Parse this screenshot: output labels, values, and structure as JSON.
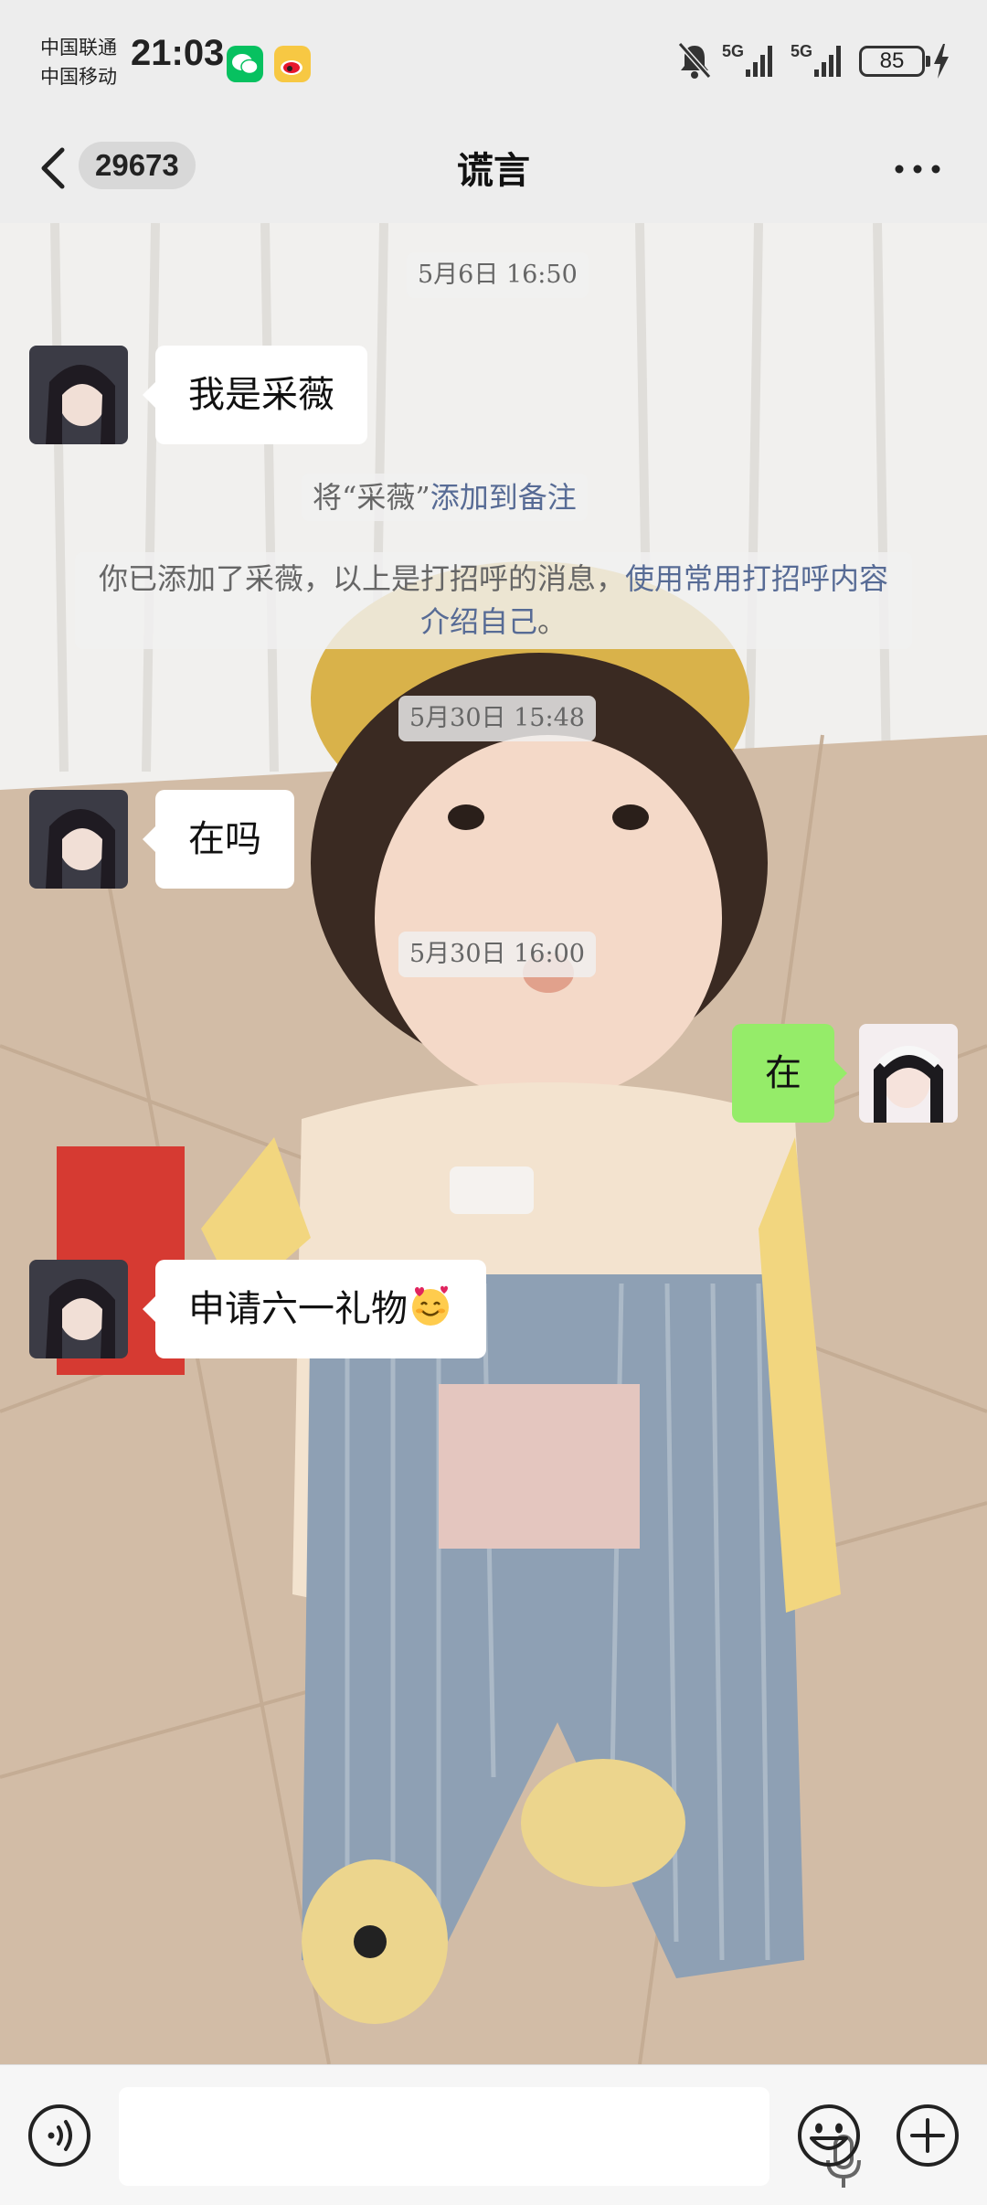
{
  "status_bar": {
    "carrier_1": "中国联通",
    "carrier_2": "中国移动",
    "time": "21:03",
    "network_1": "5G",
    "network_2": "5G",
    "battery": "85"
  },
  "header": {
    "unread_count": "29673",
    "title": "谎言"
  },
  "messages": [
    {
      "kind": "timestamp",
      "text": "5月6日 16:50"
    },
    {
      "kind": "incoming",
      "text": "我是采薇"
    },
    {
      "kind": "system",
      "prefix": "将“采薇”",
      "link": "添加到备注"
    },
    {
      "kind": "system",
      "prefix": "你已添加了采薇，以上是打招呼的消息，",
      "link": "使用常用打招呼内容介绍自己",
      "suffix": "。"
    },
    {
      "kind": "timestamp",
      "text": "5月30日 15:48"
    },
    {
      "kind": "incoming",
      "text": "在吗"
    },
    {
      "kind": "timestamp",
      "text": "5月30日 16:00"
    },
    {
      "kind": "outgoing",
      "text": "在"
    },
    {
      "kind": "incoming",
      "text": "申请六一礼物",
      "emoji": "smiling-face-with-hearts"
    }
  ],
  "input_bar": {
    "left_icon": "voice-icon",
    "mic_icon": "mic-icon",
    "emoji_icon": "emoji-icon",
    "plus_icon": "plus-icon"
  },
  "colors": {
    "outgoing_bubble": "#95ec69",
    "incoming_bubble": "#ffffff",
    "link": "#576b95",
    "bar_background": "#ededed"
  }
}
